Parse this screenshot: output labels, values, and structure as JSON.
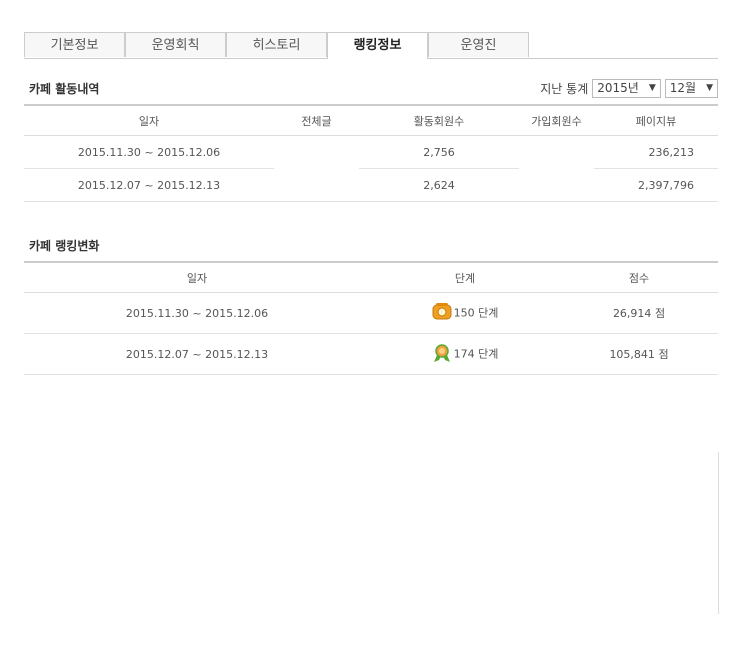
{
  "tabs": [
    {
      "label": "기본정보",
      "active": false
    },
    {
      "label": "운영회칙",
      "active": false
    },
    {
      "label": "히스토리",
      "active": false
    },
    {
      "label": "랭킹정보",
      "active": true
    },
    {
      "label": "운영진",
      "active": false
    }
  ],
  "activity": {
    "title": "카페 활동내역",
    "filter_label": "지난 통계",
    "year_value": "2015년",
    "month_value": "12월",
    "headers": [
      "일자",
      "전체글",
      "활동회원수",
      "가입회원수",
      "페이지뷰"
    ],
    "rows": [
      {
        "date": "2015.11.30 ~ 2015.12.06",
        "posts": "",
        "active_members": "2,756",
        "new_members": "",
        "pageviews": "236,213"
      },
      {
        "date": "2015.12.07 ~ 2015.12.13",
        "posts": "",
        "active_members": "2,624",
        "new_members": "",
        "pageviews": "2,397,796"
      }
    ]
  },
  "ranking": {
    "title": "카페 랭킹변화",
    "headers": [
      "일자",
      "단계",
      "점수"
    ],
    "rows": [
      {
        "date": "2015.11.30 ~ 2015.12.06",
        "level": "150",
        "level_unit": "단계",
        "score": "26,914",
        "score_unit": "점",
        "icon": "phone-grade-icon"
      },
      {
        "date": "2015.12.07 ~ 2015.12.13",
        "level": "174",
        "level_unit": "단계",
        "score": "105,841",
        "score_unit": "점",
        "icon": "medal-grade-icon"
      }
    ]
  },
  "colors": {
    "border": "#cccccc",
    "grade_orange": "#f0a020",
    "grade_green": "#5aa832"
  }
}
